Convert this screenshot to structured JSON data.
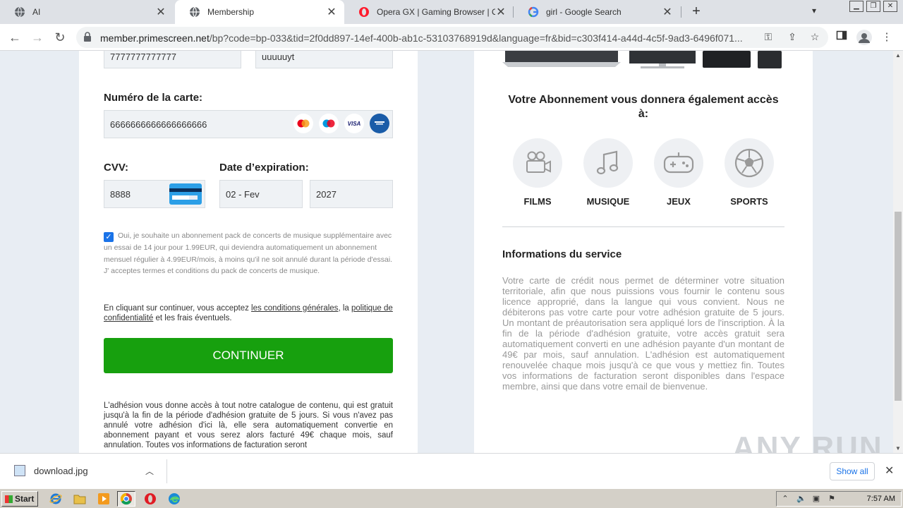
{
  "browser": {
    "tabs": [
      {
        "label": "AI",
        "icon": "globe-icon"
      },
      {
        "label": "Membership",
        "icon": "globe-icon"
      },
      {
        "label": "Opera GX | Gaming Browser | Opera",
        "icon": "opera-icon"
      },
      {
        "label": "girl - Google Search",
        "icon": "google-icon"
      }
    ],
    "url_host": "member.primescreen.net",
    "url_rest": "/bp?code=bp-033&tid=2f0dd897-14ef-400b-ab1c-53103768919d&language=fr&bid=c303f414-a44d-4c5f-9ad3-6496f071..."
  },
  "form": {
    "top_field_1": "7777777777777",
    "top_field_2": "uuuuuyt",
    "card_label": "Numéro de la carte:",
    "card_number": "6666666666666666666",
    "card_logos": [
      "mastercard",
      "maestro",
      "VISA",
      "visa-platinum"
    ],
    "cvv_label": "CVV:",
    "cvv_value": "8888",
    "expiry_label": "Date d’expiration:",
    "expiry_month": "02 - Fev",
    "expiry_year": "2027",
    "consent_text": "Oui, je souhaite un abonnement pack de concerts de musique supplémentaire avec un essai de 14 jour pour 1.99EUR, qui deviendra automatiquement un abonnement mensuel régulier à 4.99EUR/mois, à moins qu'il ne soit annulé durant la période d'essai. J' acceptes termes et conditions du pack de concerts de musique.",
    "terms_prefix": "En cliquant sur continuer, vous acceptez ",
    "terms_link": "les conditions générales",
    "terms_mid": ", la ",
    "privacy_link": "politique de confidentialité",
    "terms_suffix": " et les frais éventuels.",
    "continue_label": "CONTINUER",
    "disclaimer": "L'adhésion vous donne accès à tout notre catalogue de contenu, qui est gratuit jusqu'à la fin de la période d'adhésion gratuite de 5 jours. Si vous n'avez pas annulé votre adhésion d'ici là, elle sera automatiquement convertie en abonnement payant et vous serez alors facturé 49€ chaque mois, sauf annulation. Toutes vos informations de facturation seront"
  },
  "benefits": {
    "heading": "Votre Abonnement vous donnera également accès à:",
    "items": [
      {
        "label": "FILMS",
        "icon": "film-camera-icon"
      },
      {
        "label": "MUSIQUE",
        "icon": "music-note-icon"
      },
      {
        "label": "JEUX",
        "icon": "gamepad-icon"
      },
      {
        "label": "SPORTS",
        "icon": "soccer-ball-icon"
      }
    ],
    "service_title": "Informations du service",
    "service_text": "Votre carte de crédit nous permet de déterminer votre situation territoriale, afin que nous puissions vous fournir le contenu sous licence approprié, dans la langue qui vous convient. Nous ne débiterons pas votre carte pour votre adhésion gratuite de 5 jours. Un montant de préautorisation sera appliqué lors de l'inscription. À la fin de la période d'adhésion gratuite, votre accès gratuit sera automatiquement converti en une adhésion payante d'un montant de 49€ par mois, sauf annulation. L'adhésion est automatiquement renouvelée chaque mois jusqu'à ce que vous y mettiez fin. Toutes vos informations de facturation seront disponibles dans l'espace membre, ainsi que dans votre email de bienvenue."
  },
  "watermark": "ANY RUN",
  "download": {
    "filename": "download.jpg",
    "show_all": "Show all"
  },
  "taskbar": {
    "start": "Start",
    "clock": "7:57 AM"
  },
  "colors": {
    "continue": "#17a00e",
    "link": "#1a73e8",
    "tab_strip": "#dee1e6"
  }
}
